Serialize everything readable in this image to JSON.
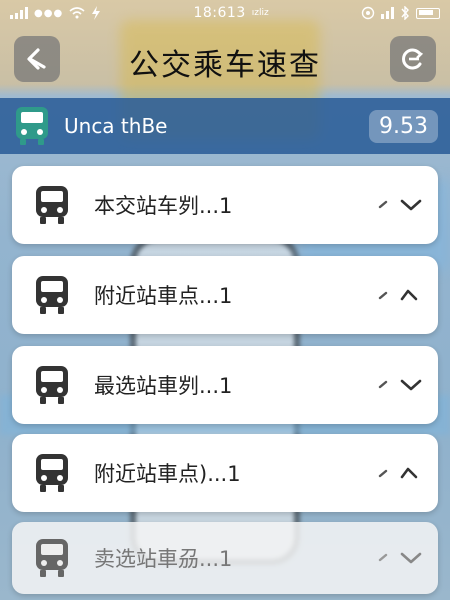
{
  "status_bar": {
    "time": "18:613",
    "small_text": "ızliz"
  },
  "header": {
    "title": "公交乘车速查"
  },
  "route": {
    "name": "Unca thBe",
    "value": "9.53"
  },
  "items": [
    {
      "label": "本交站车刿...1",
      "chevron": "down"
    },
    {
      "label": "附近站車点...1",
      "chevron": "up"
    },
    {
      "label": "最选站車刿...1",
      "chevron": "down"
    },
    {
      "label": "附近站車点)...1",
      "chevron": "up"
    },
    {
      "label": "卖选站車刕...1",
      "chevron": "down"
    }
  ],
  "colors": {
    "route_bar": "#285a96",
    "card": "#ffffff",
    "header_button": "#787878"
  },
  "icons": {
    "back": "back-arrow-icon",
    "refresh": "refresh-icon",
    "bus": "bus-icon"
  }
}
